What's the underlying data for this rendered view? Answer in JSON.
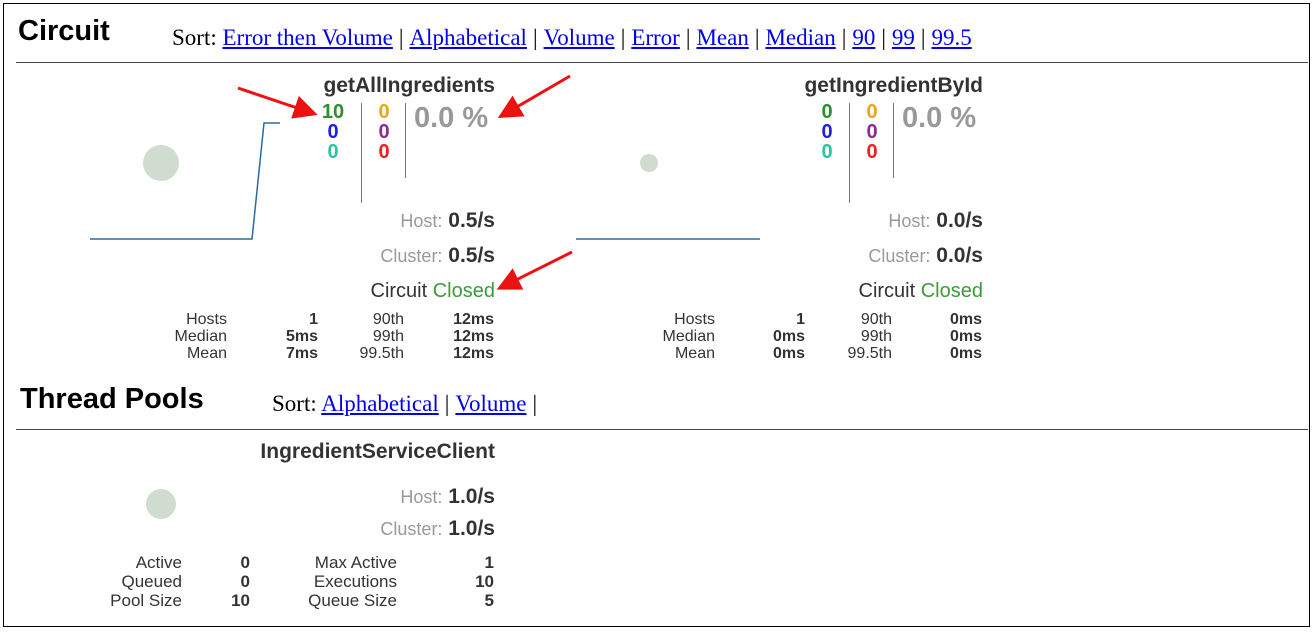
{
  "circuit": {
    "title": "Circuit",
    "sort_label": "Sort:",
    "sort_links": [
      "Error then Volume",
      "Alphabetical",
      "Volume",
      "Error",
      "Mean",
      "Median",
      "90",
      "99",
      "99.5"
    ],
    "cards": [
      {
        "name": "getAllIngredients",
        "counts": {
          "success": "10",
          "short_circuited": "0",
          "timeout": "0",
          "bad_request": "0",
          "rejected": "0",
          "failure": "0"
        },
        "error_pct": "0.0 %",
        "host_label": "Host:",
        "host_rate": "0.5/s",
        "cluster_label": "Cluster:",
        "cluster_rate": "0.5/s",
        "circuit_label": "Circuit",
        "circuit_status": "Closed",
        "stats": {
          "labels": [
            "Hosts",
            "Median",
            "Mean"
          ],
          "values": [
            "1",
            "5ms",
            "7ms"
          ],
          "pct_labels": [
            "90th",
            "99th",
            "99.5th"
          ],
          "pct_values": [
            "12ms",
            "12ms",
            "12ms"
          ]
        }
      },
      {
        "name": "getIngredientById",
        "counts": {
          "success": "0",
          "short_circuited": "0",
          "timeout": "0",
          "bad_request": "0",
          "rejected": "0",
          "failure": "0"
        },
        "error_pct": "0.0 %",
        "host_label": "Host:",
        "host_rate": "0.0/s",
        "cluster_label": "Cluster:",
        "cluster_rate": "0.0/s",
        "circuit_label": "Circuit",
        "circuit_status": "Closed",
        "stats": {
          "labels": [
            "Hosts",
            "Median",
            "Mean"
          ],
          "values": [
            "1",
            "0ms",
            "0ms"
          ],
          "pct_labels": [
            "90th",
            "99th",
            "99.5th"
          ],
          "pct_values": [
            "0ms",
            "0ms",
            "0ms"
          ]
        }
      }
    ]
  },
  "thread_pools": {
    "title": "Thread Pools",
    "sort_label": "Sort:",
    "sort_links": [
      "Alphabetical",
      "Volume"
    ],
    "pool": {
      "name": "IngredientServiceClient",
      "host_label": "Host:",
      "host_rate": "1.0/s",
      "cluster_label": "Cluster:",
      "cluster_rate": "1.0/s",
      "left_labels": [
        "Active",
        "Queued",
        "Pool Size"
      ],
      "left_values": [
        "0",
        "0",
        "10"
      ],
      "right_labels": [
        "Max Active",
        "Executions",
        "Queue Size"
      ],
      "right_values": [
        "1",
        "10",
        "5"
      ]
    }
  },
  "colors": {
    "success": "#2d8f2d",
    "short_circuited": "#1e1ee6",
    "timeout": "#29c4a0",
    "bad_request": "#f0a31e",
    "rejected": "#8e2b8e",
    "failure": "#ee2222",
    "annotation_arrow": "#ee1111",
    "link": "#0000ee"
  }
}
